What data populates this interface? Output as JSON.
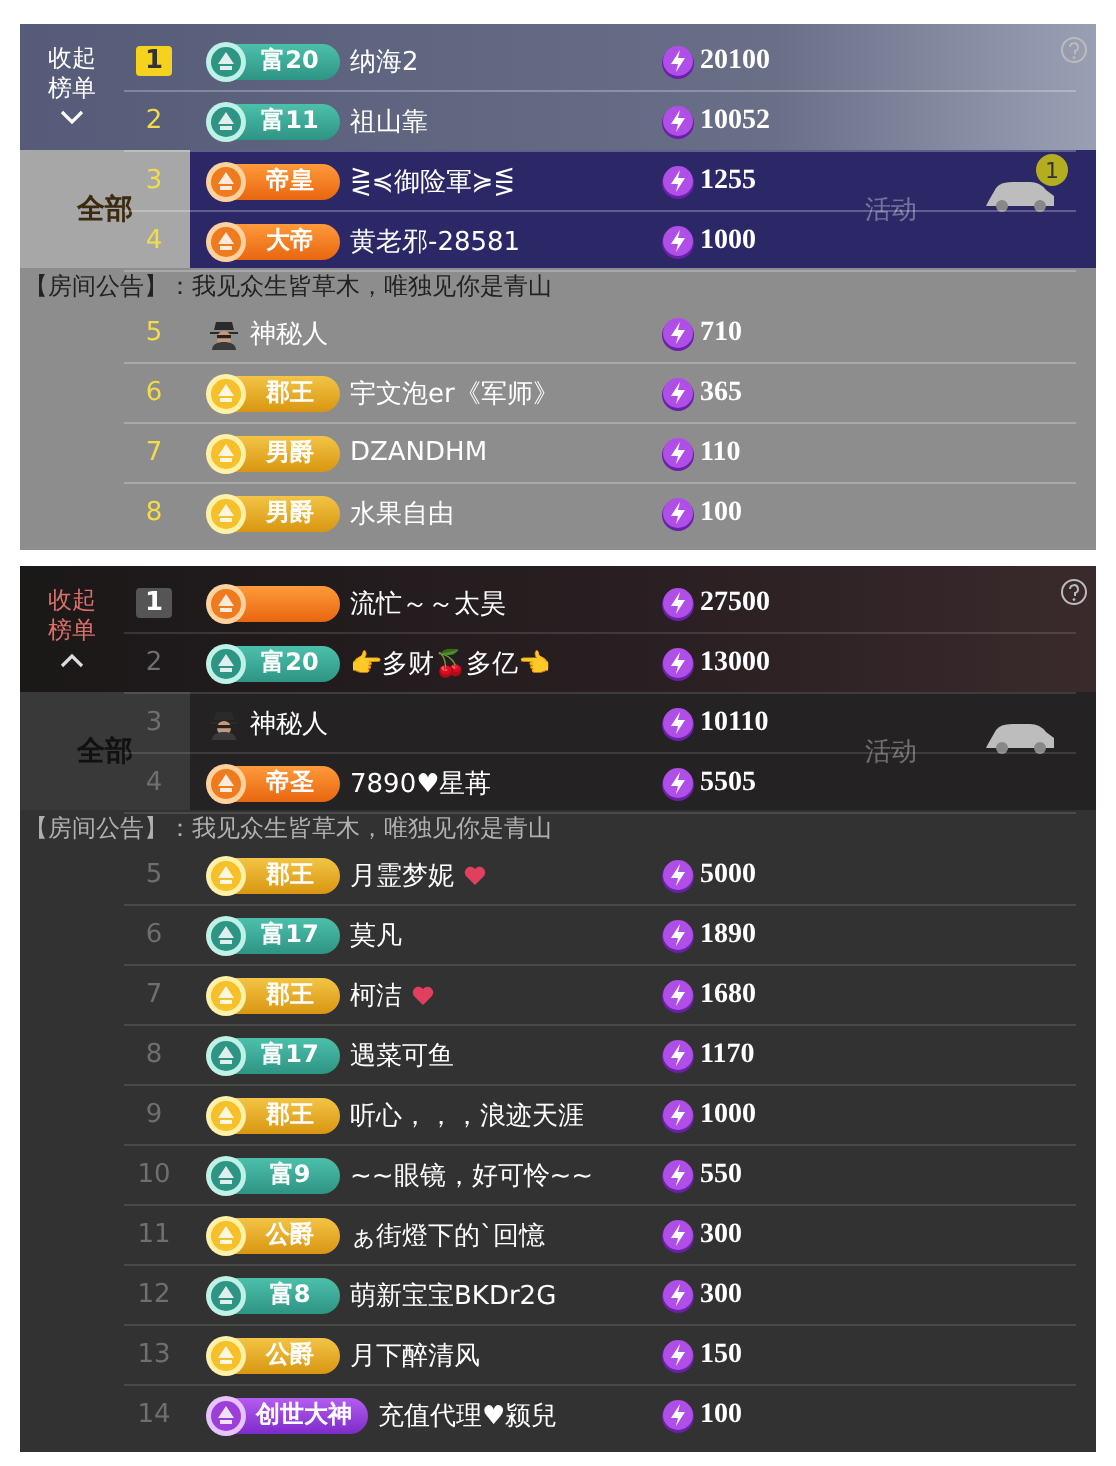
{
  "panels": [
    {
      "collapse_label": "收起榜单",
      "expanded": false,
      "tabs": [
        {
          "label": "全部",
          "selected": true
        },
        {
          "label": "活动",
          "selected": false
        }
      ],
      "car_badge": "1",
      "announcement": "【房间公告】：我见众生皆草木，唯独见你是青山",
      "rows": [
        {
          "rank": "1",
          "boxed": true,
          "badge": {
            "kind": "wealth",
            "label": "富20"
          },
          "name": "纳海2",
          "heart": false,
          "value": "20100"
        },
        {
          "rank": "2",
          "boxed": false,
          "badge": {
            "kind": "wealth",
            "label": "富11"
          },
          "name": "祖山靠",
          "heart": false,
          "value": "10052"
        },
        {
          "rank": "3",
          "boxed": false,
          "badge": {
            "kind": "emperor",
            "label": "帝皇"
          },
          "name": "⋛≼御险軍≽⋚",
          "heart": false,
          "value": "1255"
        },
        {
          "rank": "4",
          "boxed": false,
          "badge": {
            "kind": "emperor",
            "label": "大帝"
          },
          "name": "黄老邪-28581",
          "heart": false,
          "value": "1000"
        },
        {
          "rank": "5",
          "boxed": false,
          "badge": {
            "kind": "incognito"
          },
          "name": "神秘人",
          "heart": false,
          "value": "710"
        },
        {
          "rank": "6",
          "boxed": false,
          "badge": {
            "kind": "noble",
            "label": "郡王"
          },
          "name": "宇文泡er《军师》",
          "heart": false,
          "value": "365"
        },
        {
          "rank": "7",
          "boxed": false,
          "badge": {
            "kind": "noble",
            "label": "男爵"
          },
          "name": "DZANDHM",
          "heart": false,
          "value": "110"
        },
        {
          "rank": "8",
          "boxed": false,
          "badge": {
            "kind": "noble",
            "label": "男爵"
          },
          "name": "水果自由",
          "heart": false,
          "value": "100"
        }
      ]
    },
    {
      "collapse_label": "收起榜单",
      "expanded": true,
      "tabs": [
        {
          "label": "全部",
          "selected": true
        },
        {
          "label": "活动",
          "selected": false
        }
      ],
      "announcement": "【房间公告】：我见众生皆草木，唯独见你是青山",
      "rows": [
        {
          "rank": "1",
          "boxed": true,
          "badge": {
            "kind": "emperor"
          },
          "name": "流忙～～太昊",
          "heart": false,
          "value": "27500"
        },
        {
          "rank": "2",
          "boxed": false,
          "badge": {
            "kind": "wealth",
            "label": "富20"
          },
          "name": "👉多财🍒多亿👈",
          "heart": false,
          "value": "13000"
        },
        {
          "rank": "3",
          "boxed": false,
          "badge": {
            "kind": "incognito"
          },
          "name": "神秘人",
          "heart": false,
          "value": "10110"
        },
        {
          "rank": "4",
          "boxed": false,
          "badge": {
            "kind": "emperor",
            "label": "帝圣"
          },
          "name": "7890♥星苒",
          "heart": false,
          "value": "5505"
        },
        {
          "rank": "5",
          "boxed": false,
          "badge": {
            "kind": "noble",
            "label": "郡王"
          },
          "name": "月霊梦妮",
          "heart": true,
          "value": "5000"
        },
        {
          "rank": "6",
          "boxed": false,
          "badge": {
            "kind": "wealth",
            "label": "富17"
          },
          "name": "莫凡",
          "heart": false,
          "value": "1890"
        },
        {
          "rank": "7",
          "boxed": false,
          "badge": {
            "kind": "noble",
            "label": "郡王"
          },
          "name": "柯洁",
          "heart": true,
          "value": "1680"
        },
        {
          "rank": "8",
          "boxed": false,
          "badge": {
            "kind": "wealth",
            "label": "富17"
          },
          "name": "遇菜可鱼",
          "heart": false,
          "value": "1170"
        },
        {
          "rank": "9",
          "boxed": false,
          "badge": {
            "kind": "noble",
            "label": "郡王"
          },
          "name": "听心，，，浪迹天涯",
          "heart": false,
          "value": "1000"
        },
        {
          "rank": "10",
          "boxed": false,
          "badge": {
            "kind": "wealth",
            "label": "富9"
          },
          "name": "~~眼镜，好可怜~~",
          "heart": false,
          "value": "550"
        },
        {
          "rank": "11",
          "boxed": false,
          "badge": {
            "kind": "noble",
            "label": "公爵"
          },
          "name": "ぁ街燈下的`回憶",
          "heart": false,
          "value": "300"
        },
        {
          "rank": "12",
          "boxed": false,
          "badge": {
            "kind": "wealth",
            "label": "富8"
          },
          "name": "萌新宝宝BKDr2G",
          "heart": false,
          "value": "300"
        },
        {
          "rank": "13",
          "boxed": false,
          "badge": {
            "kind": "noble",
            "label": "公爵"
          },
          "name": "月下醉清风",
          "heart": false,
          "value": "150"
        },
        {
          "rank": "14",
          "boxed": false,
          "badge": {
            "kind": "god",
            "label": "创世大神"
          },
          "name": "充值代理♥颍兒",
          "heart": false,
          "value": "100"
        }
      ]
    }
  ]
}
